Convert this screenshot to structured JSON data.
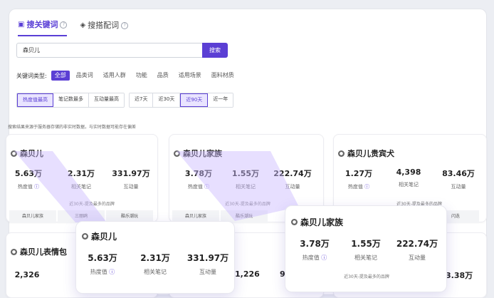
{
  "tabs": [
    {
      "label": "搜关键词",
      "icon": "chat-icon"
    },
    {
      "label": "搜搭配词",
      "icon": "tag-icon"
    }
  ],
  "search": {
    "value": "森贝儿",
    "button": "搜索"
  },
  "filters": {
    "label": "关键词类型:",
    "items": [
      "全部",
      "品类词",
      "适用人群",
      "功能",
      "品质",
      "适用场景",
      "面料材质"
    ]
  },
  "sort": {
    "metrics": [
      "热度值最高",
      "笔记数最多",
      "互动量最高"
    ],
    "ranges": [
      "近7天",
      "近30天",
      "近90天",
      "近一年"
    ]
  },
  "note": "搜索结果来源于服务器存储的非实时数据，与实时数据可能存在偏差",
  "cards": [
    {
      "title": "森贝儿",
      "metrics": [
        {
          "value": "5.63万",
          "label": "热度值"
        },
        {
          "value": "2.31万",
          "label": "相关笔记"
        },
        {
          "value": "331.97万",
          "label": "互动量"
        }
      ],
      "sub": "近30天-提及最多的品牌",
      "tags": [
        "森贝儿家族",
        "三丽鸥",
        "酷乐潮玩"
      ]
    },
    {
      "title": "森贝儿家族",
      "metrics": [
        {
          "value": "3.78万",
          "label": "热度值"
        },
        {
          "value": "1.55万",
          "label": "相关笔记"
        },
        {
          "value": "222.74万",
          "label": "互动量"
        }
      ],
      "sub": "近30天-提及最多的品牌",
      "tags": [
        "森贝儿家族",
        "酷乐潮玩"
      ]
    },
    {
      "title": "森贝儿贵宾犬",
      "metrics": [
        {
          "value": "1.27万",
          "label": "热度值"
        },
        {
          "value": "4,398",
          "label": "相关笔记"
        },
        {
          "value": "83.46万",
          "label": "互动量"
        }
      ],
      "sub": "近30天-提及最多的品牌",
      "tags": [
        "闪迭"
      ]
    },
    {
      "title": "森贝儿表情包",
      "metrics": [
        {
          "value": "2,326",
          "label": ""
        }
      ]
    }
  ],
  "partial": {
    "a": "1,226",
    "b": "9",
    "c": "3.38万"
  },
  "popup_left": {
    "title": "森贝儿",
    "metrics": [
      {
        "value": "5.63万",
        "label": "热度值"
      },
      {
        "value": "2.31万",
        "label": "相关笔记"
      },
      {
        "value": "331.97万",
        "label": "互动量"
      }
    ]
  },
  "popup_right": {
    "title": "森贝儿家族",
    "metrics": [
      {
        "value": "3.78万",
        "label": "热度值"
      },
      {
        "value": "1.55万",
        "label": "相关笔记"
      },
      {
        "value": "222.74万",
        "label": "互动量"
      }
    ],
    "sub": "近30天-提及最多的品牌"
  },
  "colors": {
    "accent": "#5b3fd4",
    "beam": "#c9b8ff"
  }
}
